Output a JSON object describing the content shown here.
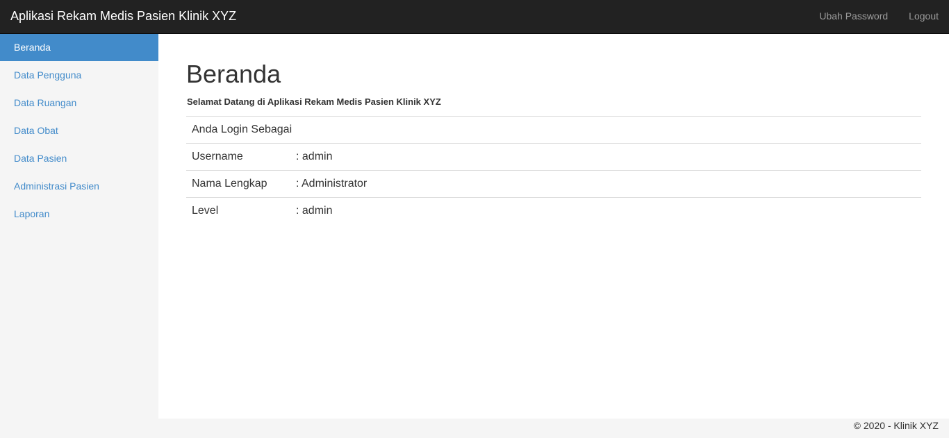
{
  "navbar": {
    "brand": "Aplikasi Rekam Medis Pasien Klinik XYZ",
    "links": [
      {
        "label": "Ubah Password"
      },
      {
        "label": "Logout"
      }
    ]
  },
  "sidebar": {
    "items": [
      {
        "label": "Beranda",
        "active": true
      },
      {
        "label": "Data Pengguna"
      },
      {
        "label": "Data Ruangan"
      },
      {
        "label": "Data Obat"
      },
      {
        "label": "Data Pasien"
      },
      {
        "label": "Administrasi Pasien"
      },
      {
        "label": "Laporan"
      }
    ]
  },
  "main": {
    "title": "Beranda",
    "welcome": "Selamat Datang di Aplikasi Rekam Medis Pasien Klinik XYZ",
    "table": {
      "heading": "Anda Login Sebagai",
      "rows": [
        {
          "label": "Username",
          "value": ": admin"
        },
        {
          "label": "Nama Lengkap",
          "value": ": Administrator"
        },
        {
          "label": "Level",
          "value": ": admin"
        }
      ]
    }
  },
  "footer": {
    "text": "© 2020 - Klinik XYZ"
  },
  "colors": {
    "navbar_bg": "#222222",
    "accent": "#428bca",
    "sidebar_bg": "#f5f5f5"
  }
}
